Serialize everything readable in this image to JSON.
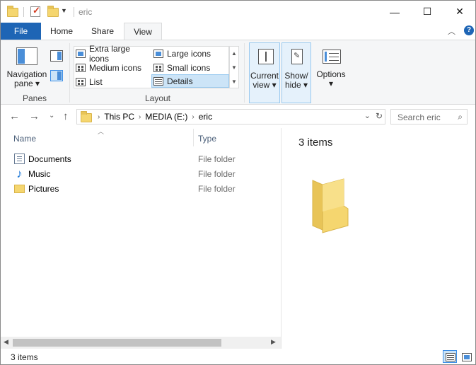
{
  "window": {
    "title": "eric"
  },
  "caption": {
    "minimize": "—",
    "maximize": "☐",
    "close": "✕"
  },
  "ribbon_tabs": [
    "File",
    "Home",
    "Share",
    "View"
  ],
  "ribbon": {
    "panes": {
      "navigation_pane": "Navigation\npane ▾",
      "group_label": "Panes"
    },
    "layout": {
      "items": [
        "Extra large icons",
        "Large icons",
        "Medium icons",
        "Small icons",
        "List",
        "Details"
      ],
      "selected": "Details",
      "group_label": "Layout"
    },
    "current_view": "Current\nview ▾",
    "show_hide": "Show/\nhide ▾",
    "options": "Options\n▾"
  },
  "breadcrumb": [
    "This PC",
    "MEDIA (E:)",
    "eric"
  ],
  "search": {
    "placeholder": "Search eric"
  },
  "columns": {
    "name": "Name",
    "type": "Type"
  },
  "files": [
    {
      "name": "Documents",
      "type": "File folder",
      "icon": "documents-icon"
    },
    {
      "name": "Music",
      "type": "File folder",
      "icon": "music-icon"
    },
    {
      "name": "Pictures",
      "type": "File folder",
      "icon": "pictures-folder-icon"
    }
  ],
  "preview": {
    "count_text": "3 items"
  },
  "status": {
    "items_text": "3 items"
  },
  "colors": {
    "accent": "#1e65b5",
    "selection": "#cce4f7",
    "folder": "#f5d66f"
  }
}
